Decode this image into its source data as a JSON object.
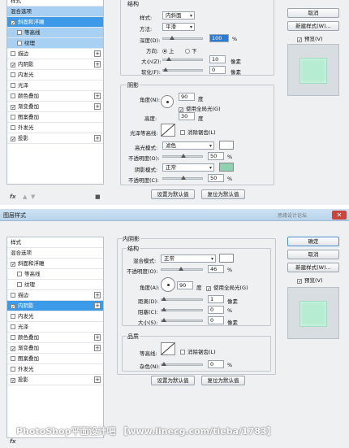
{
  "panel1": {
    "list": {
      "header": "样式",
      "items": [
        {
          "label": "混合选项",
          "checked": null,
          "state": "lite"
        },
        {
          "label": "斜面和浮雕",
          "checked": true,
          "state": "sel"
        },
        {
          "label": "等高线",
          "checked": false,
          "state": "lite-sub"
        },
        {
          "label": "纹理",
          "checked": false,
          "state": "lite-sub"
        },
        {
          "label": "描边",
          "checked": false,
          "plus": true
        },
        {
          "label": "内阴影",
          "checked": true,
          "plus": true
        },
        {
          "label": "内发光",
          "checked": false
        },
        {
          "label": "光泽",
          "checked": false
        },
        {
          "label": "颜色叠加",
          "checked": false,
          "plus": true
        },
        {
          "label": "渐变叠加",
          "checked": true,
          "plus": true
        },
        {
          "label": "图案叠加",
          "checked": false
        },
        {
          "label": "外发光",
          "checked": false
        },
        {
          "label": "投影",
          "checked": true,
          "plus": true
        }
      ],
      "footer_fx": "fx",
      "footer_up": "▲",
      "footer_down": "▼",
      "footer_trash": "🗑"
    },
    "structure": {
      "legend": "结构",
      "style_label": "样式:",
      "style_value": "内斜面",
      "method_label": "方法:",
      "method_value": "平滑",
      "depth_label": "深度(D):",
      "depth_value": "100",
      "depth_unit": "%",
      "dir_label": "方向:",
      "dir_up": "上",
      "dir_down": "下",
      "size_label": "大小(Z):",
      "size_value": "10",
      "size_unit": "像素",
      "soften_label": "软化(F):",
      "soften_value": "0",
      "soften_unit": "像素"
    },
    "shading": {
      "legend": "阴影",
      "angle_label": "角度(N):",
      "angle_value": "90",
      "angle_unit": "度",
      "global_light": "使用全局光(G)",
      "altitude_label": "高度:",
      "altitude_value": "30",
      "altitude_unit": "度",
      "gloss_label": "光泽等高线:",
      "antialias": "消除锯齿(L)",
      "hl_mode_label": "高光模式:",
      "hl_mode_value": "滤色",
      "hl_opacity_label": "不透明度(O):",
      "hl_opacity_value": "50",
      "shadow_mode_label": "阴影模式:",
      "shadow_mode_value": "正常",
      "shadow_opacity_label": "不透明度(C):",
      "shadow_opacity_value": "50",
      "pct": "%"
    },
    "buttons": {
      "make_default": "设置为默认值",
      "reset_default": "复位为默认值"
    },
    "side": {
      "cancel": "取消",
      "new_style": "新建样式(W)...",
      "preview": "预览(V)"
    }
  },
  "panel2": {
    "window_title": "图层样式",
    "watermark_title": "思缘设计论坛",
    "close": "✕",
    "list": {
      "header": "样式",
      "items": [
        {
          "label": "混合选项",
          "checked": null
        },
        {
          "label": "斜面和浮雕",
          "checked": true
        },
        {
          "label": "等高线",
          "checked": false,
          "sub": true
        },
        {
          "label": "纹理",
          "checked": false,
          "sub": true
        },
        {
          "label": "描边",
          "checked": false,
          "plus": true
        },
        {
          "label": "内阴影",
          "checked": true,
          "plus": true,
          "sel": true
        },
        {
          "label": "内发光",
          "checked": false
        },
        {
          "label": "光泽",
          "checked": false
        },
        {
          "label": "颜色叠加",
          "checked": false,
          "plus": true
        },
        {
          "label": "渐变叠加",
          "checked": true,
          "plus": true
        },
        {
          "label": "图案叠加",
          "checked": false
        },
        {
          "label": "外发光",
          "checked": false
        },
        {
          "label": "投影",
          "checked": true,
          "plus": true
        }
      ],
      "footer_fx": "fx"
    },
    "inner_shadow": {
      "title": "内阴影",
      "structure": "结构",
      "blend_label": "混合模式:",
      "blend_value": "正常",
      "opacity_label": "不透明度(O):",
      "opacity_value": "46",
      "angle_label": "角度(A):",
      "angle_value": "90",
      "angle_unit": "度",
      "global_light": "使用全局光(G)",
      "distance_label": "距离(D):",
      "distance_value": "1",
      "choke_label": "阻塞(C):",
      "choke_value": "0",
      "size_label": "大小(S):",
      "size_value": "0",
      "px": "像素",
      "pct": "%",
      "quality": "品质",
      "contour_label": "等高线:",
      "antialias": "消除锯齿(L)",
      "noise_label": "杂色(N):",
      "noise_value": "0"
    },
    "buttons": {
      "make_default": "设置为默认值",
      "reset_default": "复位为默认值"
    },
    "side": {
      "ok": "确定",
      "cancel": "取消",
      "new_style": "新建样式(W)...",
      "preview": "预览(V)"
    }
  },
  "watermark": "PhotoShop平面设计吧 【www.linecg.com/tieba/1783】",
  "colors": {
    "selection": "#3d9ae8",
    "shadow_swatch": "#8fd1b0",
    "preview_fill": "#b6ecd2",
    "highlight_swatch": "#ffffff"
  }
}
